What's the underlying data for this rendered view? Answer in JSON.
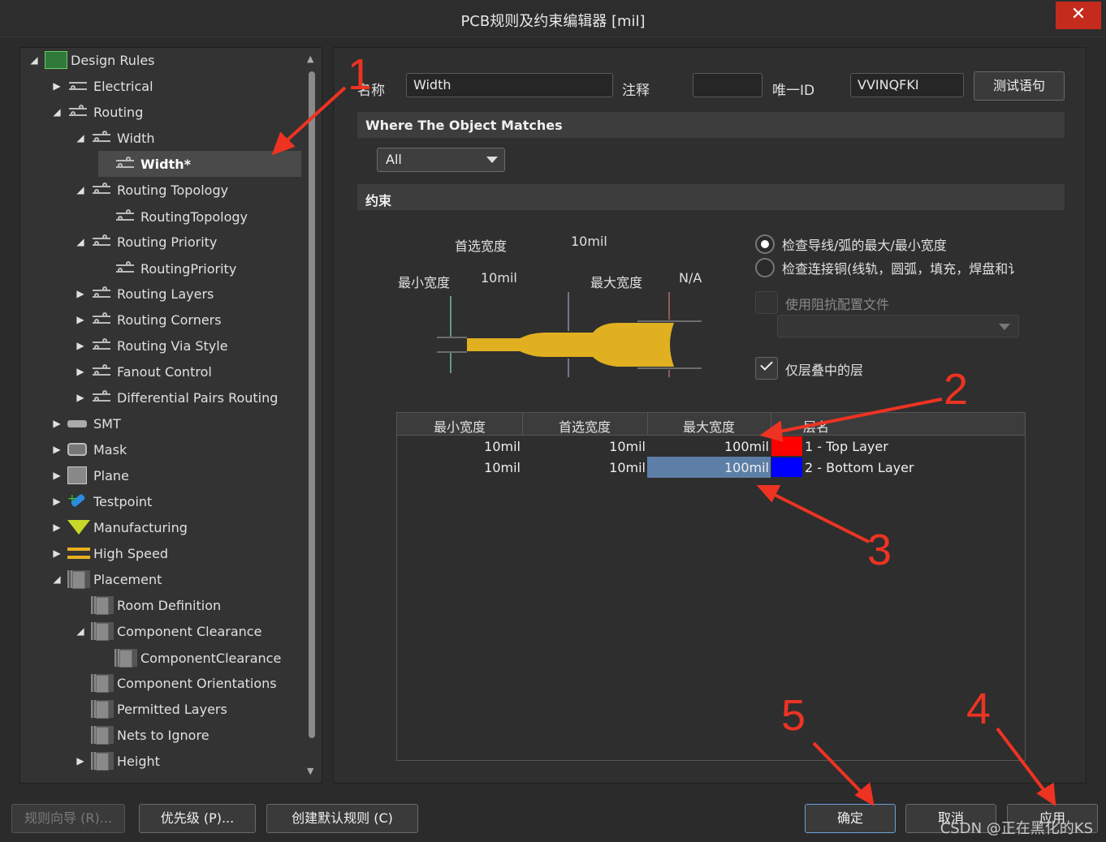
{
  "window": {
    "title": "PCB规则及约束编辑器 [mil]",
    "close_glyph": "✕"
  },
  "tree": [
    {
      "label": "Design Rules",
      "arrow": "◢"
    },
    {
      "label": "Electrical",
      "arrow": "▶"
    },
    {
      "label": "Routing",
      "arrow": "◢"
    },
    {
      "label": "Width",
      "arrow": "◢"
    },
    {
      "label": "Width*",
      "arrow": ""
    },
    {
      "label": "Routing Topology",
      "arrow": "◢"
    },
    {
      "label": "RoutingTopology",
      "arrow": ""
    },
    {
      "label": "Routing Priority",
      "arrow": "◢"
    },
    {
      "label": "RoutingPriority",
      "arrow": ""
    },
    {
      "label": "Routing Layers",
      "arrow": "▶"
    },
    {
      "label": "Routing Corners",
      "arrow": "▶"
    },
    {
      "label": "Routing Via Style",
      "arrow": "▶"
    },
    {
      "label": "Fanout Control",
      "arrow": "▶"
    },
    {
      "label": "Differential Pairs Routing",
      "arrow": "▶"
    },
    {
      "label": "SMT",
      "arrow": "▶"
    },
    {
      "label": "Mask",
      "arrow": "▶"
    },
    {
      "label": "Plane",
      "arrow": "▶"
    },
    {
      "label": "Testpoint",
      "arrow": "▶"
    },
    {
      "label": "Manufacturing",
      "arrow": "▶"
    },
    {
      "label": "High Speed",
      "arrow": "▶"
    },
    {
      "label": "Placement",
      "arrow": "◢"
    },
    {
      "label": "Room Definition",
      "arrow": ""
    },
    {
      "label": "Component Clearance",
      "arrow": "◢"
    },
    {
      "label": "ComponentClearance",
      "arrow": ""
    },
    {
      "label": "Component Orientations",
      "arrow": ""
    },
    {
      "label": "Permitted Layers",
      "arrow": ""
    },
    {
      "label": "Nets to Ignore",
      "arrow": ""
    },
    {
      "label": "Height",
      "arrow": "▶"
    }
  ],
  "rule": {
    "name_label": "名称",
    "name_value": "Width",
    "comment_label": "注释",
    "comment_value": "",
    "uid_label": "唯一ID",
    "uid_value": "VVINQFKI",
    "test_button": "测试语句"
  },
  "match": {
    "section_title": "Where The Object Matches",
    "scope_value": "All"
  },
  "constraints": {
    "section_title": "约束",
    "preferred_label": "首选宽度",
    "preferred_value": "10mil",
    "min_label": "最小宽度",
    "min_value": "10mil",
    "max_label": "最大宽度",
    "max_value": "N/A",
    "radio1": "检查导线/弧的最大/最小宽度",
    "radio2": "检查连接铜(线轨，圆弧，填充，焊盘和讠",
    "impedance_label": "使用阻抗配置文件",
    "stack_only_label": "仅层叠中的层"
  },
  "table": {
    "headers": [
      "最小宽度",
      "首选宽度",
      "最大宽度",
      "层名"
    ],
    "rows": [
      {
        "min": "10mil",
        "pref": "10mil",
        "max": "100mil",
        "color": "#ff0000",
        "layer": "1 - Top Layer"
      },
      {
        "min": "10mil",
        "pref": "10mil",
        "max": "100mil",
        "color": "#0000ff",
        "layer": "2 - Bottom Layer"
      }
    ]
  },
  "bottom": {
    "wizard": "规则向导 (R)...",
    "priority": "优先级 (P)...",
    "create_default": "创建默认规则 (C)",
    "ok": "确定",
    "cancel": "取消",
    "apply": "应用"
  },
  "annotations": [
    "1",
    "2",
    "3",
    "4",
    "5"
  ],
  "annotation_color": "#ee3322",
  "watermark": "CSDN @正在黑化的KS"
}
